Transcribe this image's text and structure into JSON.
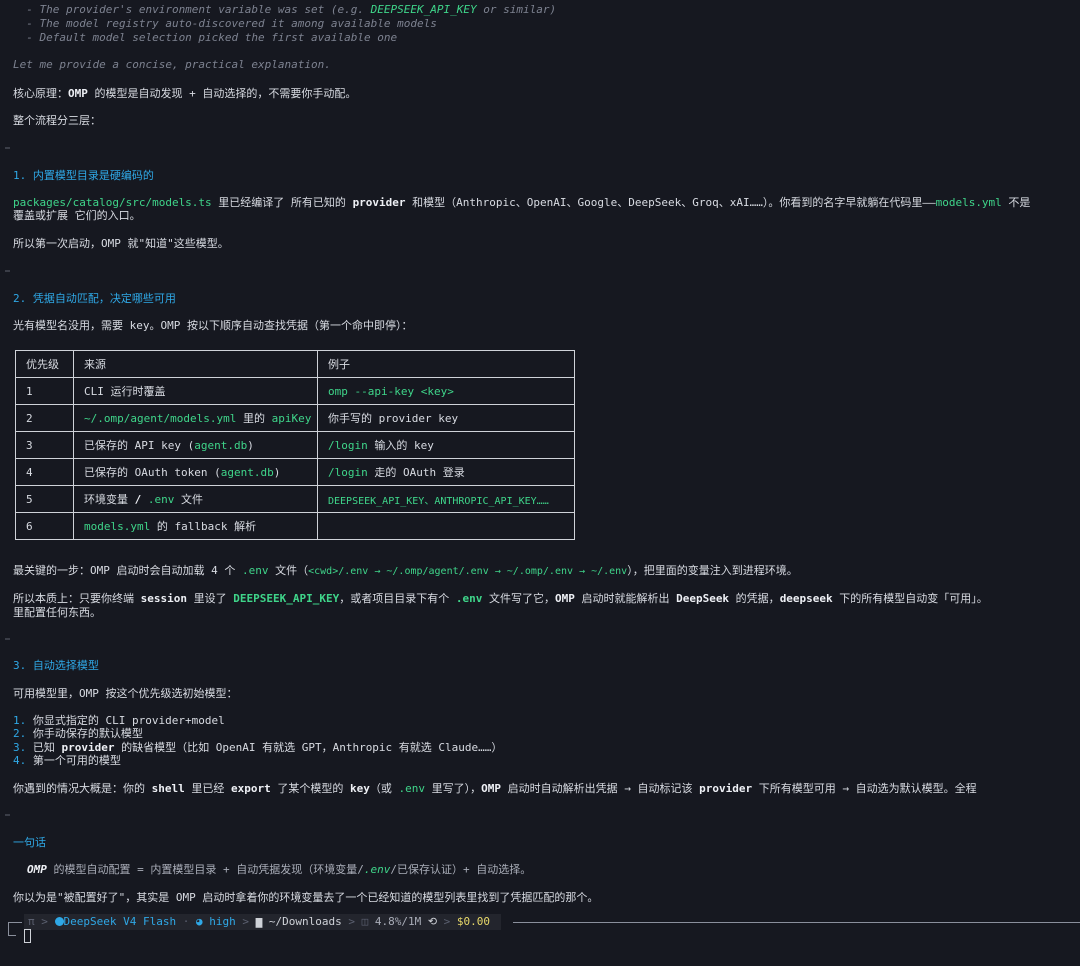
{
  "thinking": {
    "lines": [
      "  - The provider's environment variable was set (e.g. ",
      "DEEPSEEK_API_KEY",
      " or similar)",
      "  - The model registry auto-discovered it among available models",
      "  - Default model selection picked the first available one",
      "Let me provide a concise, practical explanation."
    ]
  },
  "intro": {
    "principle_prefix": "核心原理：",
    "principle_bold": "OMP",
    "principle_text": " 的模型是自动发现 + 自动选择的，不需要你手动配。",
    "flow": "整个流程分三层："
  },
  "section1": {
    "heading": "1. 内置模型目录是硬编码的",
    "path": "packages/catalog/src/models.ts",
    "text1": " 里已经编译了 所有已知的 ",
    "provider": "provider",
    "text2": " 和模型（Anthropic、OpenAI、Google、DeepSeek、Groq、xAI……）。你看到的名字早就躺在代码里——",
    "models_yml": "models.yml",
    "text3": " 不是",
    "line2": "覆盖或扩展 它们的入口。",
    "line3": "所以第一次启动，OMP 就\"知道\"这些模型。"
  },
  "section2": {
    "heading": "2. 凭据自动匹配，决定哪些可用",
    "lead": "光有模型名没用，需要 key。OMP 按以下顺序自动查找凭据（第一个命中即停）：",
    "table": {
      "headers": [
        "优先级",
        "来源",
        "例子"
      ],
      "rows": [
        {
          "p": "1",
          "src": "CLI 运行时覆盖",
          "ex_code": "omp --api-key <key>"
        },
        {
          "p": "2",
          "src_code": "~/.omp/agent/models.yml",
          "src_mid": " 里的 ",
          "src_code2": "apiKey",
          "ex": "你手写的 provider key"
        },
        {
          "p": "3",
          "src": "已保存的 API key (",
          "src_code": "agent.db",
          "src_end": ")",
          "ex_code": "/login",
          "ex": " 输入的 key"
        },
        {
          "p": "4",
          "src": "已保存的 OAuth token (",
          "src_code": "agent.db",
          "src_end": ")",
          "ex_code": "/login",
          "ex": " 走的 OAuth 登录"
        },
        {
          "p": "5",
          "src": "环境变量 ",
          "src_bold": "/",
          "src_code": " .env",
          "src_end": " 文件",
          "ex_code": "DEEPSEEK_API_KEY、ANTHROPIC_API_KEY……"
        },
        {
          "p": "6",
          "src_code": "models.yml",
          "src_end": " 的 fallback 解析",
          "ex": ""
        }
      ]
    },
    "key_step_a": "最关键的一步：OMP 启动时会自动加载 4 个 ",
    "key_env": ".env",
    "key_step_b": " 文件（",
    "key_paths": "<cwd>/.env → ~/.omp/agent/.env → ~/.omp/.env → ~/.env",
    "key_step_c": "），把里面的变量注入到进程环境。",
    "essence_a": "所以本质上：只要你终端 ",
    "essence_session": "session",
    "essence_b": " 里设了 ",
    "essence_key": "DEEPSEEK_API_KEY",
    "essence_c": "，或者项目目录下有个 ",
    "essence_env": ".env",
    "essence_d": " 文件写了它，",
    "essence_omp": "OMP",
    "essence_e": " 启动时就能解析出 ",
    "essence_ds": "DeepSeek",
    "essence_f": " 的凭据，",
    "essence_ds2": "deepseek",
    "essence_g": " 下的所有模型自动变「可用」。",
    "essence_line2": "里配置任何东西。"
  },
  "section3": {
    "heading": "3. 自动选择模型",
    "lead": "可用模型里，OMP 按这个优先级选初始模型：",
    "items": [
      {
        "num": "1.",
        "text": " 你显式指定的 CLI provider+model"
      },
      {
        "num": "2.",
        "text": " 你手动保存的默认模型"
      },
      {
        "num": "3.",
        "text_a": " 已知 ",
        "bold": "provider",
        "text_b": " 的缺省模型（比如 OpenAI 有就选 GPT，Anthropic 有就选 Claude……）"
      },
      {
        "num": "4.",
        "text": " 第一个可用的模型"
      }
    ],
    "sum_a": "你遇到的情况大概是：你的 ",
    "sum_shell": "shell",
    "sum_b": " 里已经 ",
    "sum_export": "export",
    "sum_c": " 了某个模型的 ",
    "sum_key": "key",
    "sum_d": "（或 ",
    "sum_env": ".env",
    "sum_e": " 里写了），",
    "sum_omp": "OMP",
    "sum_f": " 启动时自动解析出凭据 → 自动标记该 ",
    "sum_provider": "provider",
    "sum_g": " 下所有模型可用 → 自动选为默认模型。全程"
  },
  "summary": {
    "heading": "一句话",
    "quote_omp": "OMP",
    "quote_a": " 的模型自动配置 = 内置模型目录 + 自动凭据发现（环境变量/",
    "quote_env": ".env",
    "quote_b": "/已保存认证）+ 自动选择。",
    "closing": "你以为是\"被配置好了\"，其实是 OMP 启动时拿着你的环境变量去了一个已经知道的模型列表里找到了凭据匹配的那个。"
  },
  "statusbar": {
    "pi": "π",
    "model": "DeepSeek V4 Flash",
    "dot": "·",
    "thinking_level": "high",
    "folder": "~/Downloads",
    "context": "4.8%/1M",
    "cost": "$0.00"
  }
}
